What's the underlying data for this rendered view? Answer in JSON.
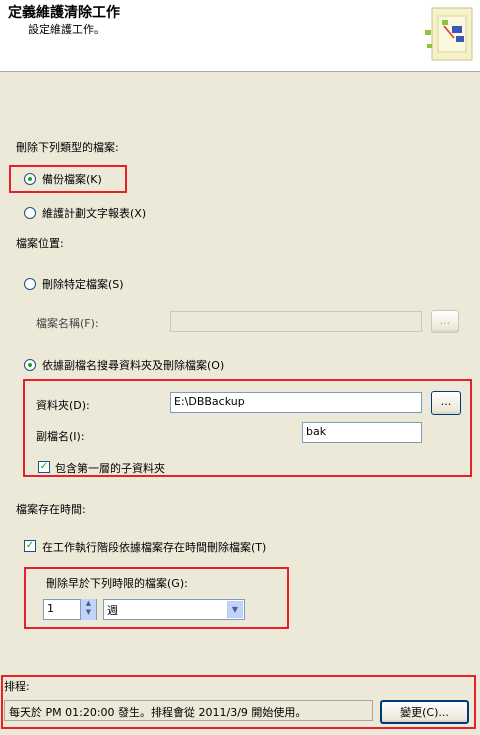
{
  "header": {
    "title": "定義維護清除工作",
    "subtitle": "設定維護工作。"
  },
  "file_type": {
    "group_label": "刪除下列類型的檔案:",
    "options": [
      {
        "label": "備份檔案(K)",
        "selected": true
      },
      {
        "label": "維護計劃文字報表(X)",
        "selected": false
      }
    ]
  },
  "file_location": {
    "group_label": "檔案位置:",
    "delete_specific_label": "刪除特定檔案(S)",
    "file_name_label": "檔案名稱(F):",
    "file_name_value": "",
    "browse_file_label": "...",
    "search_folder_label": "依據副檔名搜尋資料夾及刪除檔案(O)",
    "folder_label": "資料夾(D):",
    "folder_value": "E:\\DBBackup",
    "browse_folder_label": "...",
    "extension_label": "副檔名(I):",
    "extension_value": "bak",
    "include_subfolders_label": "包含第一層的子資料夾",
    "include_subfolders_checked": true
  },
  "file_age": {
    "group_label": "檔案存在時間:",
    "delete_by_age_label": "在工作執行階段依據檔案存在時間刪除檔案(T)",
    "delete_by_age_checked": true,
    "older_than_label": "刪除早於下列時限的檔案(G):",
    "amount_value": "1",
    "unit_value": "週"
  },
  "schedule": {
    "label": "排程:",
    "description": "每天於 PM 01:20:00 發生。排程會從 2011/3/9 開始使用。",
    "change_button_label": "變更(C)..."
  },
  "colors": {
    "highlight": "#e8202a",
    "background": "#ece9d8",
    "radio_dot": "#21a121"
  }
}
